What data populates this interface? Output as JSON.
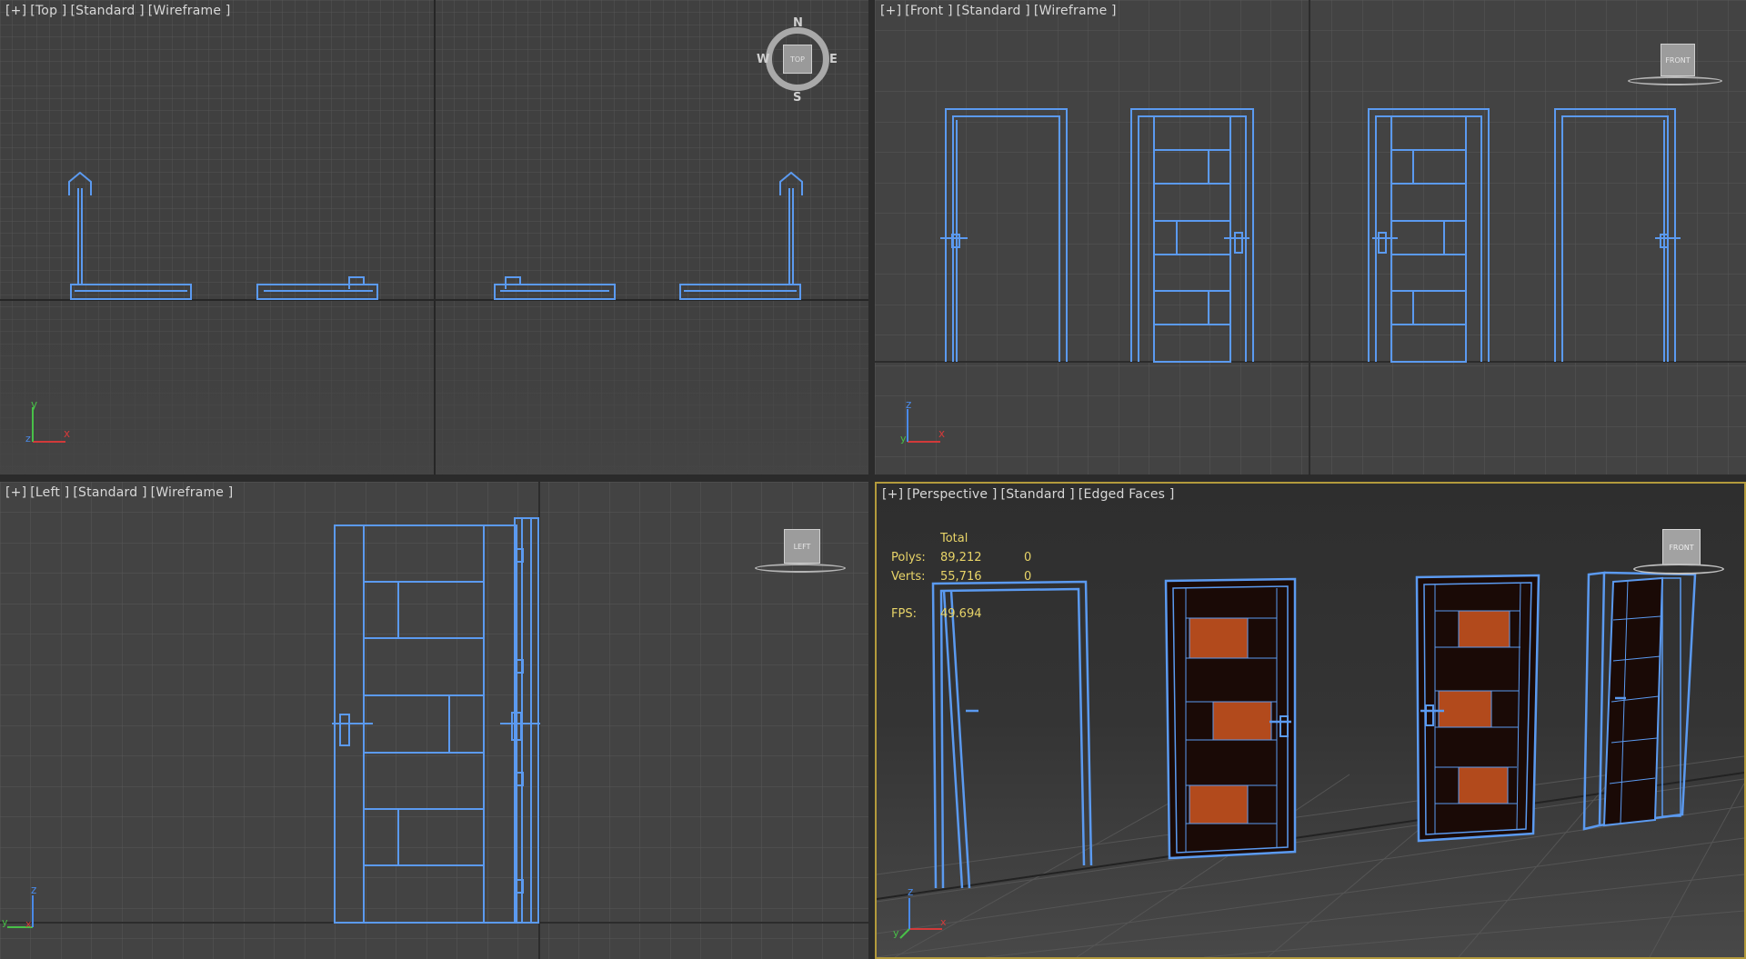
{
  "viewports": {
    "top": {
      "label": {
        "plus": "[+]",
        "view": "[Top ]",
        "shading": "[Standard ]",
        "mode": "[Wireframe ]"
      },
      "compass": {
        "n": "N",
        "s": "S",
        "e": "E",
        "w": "W",
        "cube": "TOP"
      }
    },
    "front": {
      "label": {
        "plus": "[+]",
        "view": "[Front ]",
        "shading": "[Standard ]",
        "mode": "[Wireframe ]"
      },
      "cube": "FRONT"
    },
    "left": {
      "label": {
        "plus": "[+]",
        "view": "[Left ]",
        "shading": "[Standard ]",
        "mode": "[Wireframe ]"
      },
      "cube": "LEFT"
    },
    "perspective": {
      "label": {
        "plus": "[+]",
        "view": "[Perspective ]",
        "shading": "[Standard ]",
        "mode": "[Edged Faces ]"
      },
      "cube": "FRONT",
      "stats": {
        "header": "Total",
        "polys_label": "Polys:",
        "polys_total": "89,212",
        "polys_sel": "0",
        "verts_label": "Verts:",
        "verts_total": "55,716",
        "verts_sel": "0",
        "fps_label": "FPS:",
        "fps_value": "49.694"
      }
    }
  },
  "axis_labels": {
    "x": "x",
    "y": "y",
    "z": "z"
  },
  "colors": {
    "wire": "#5b9af0",
    "grid_line": "#555555",
    "grid_major": "#2c2c2c",
    "axis_x": "#d23a3a",
    "axis_y": "#48c048",
    "axis_z": "#4a8ae8",
    "door_panel": "#1a0a06",
    "door_wood": "#b24a1c",
    "active_border": "#b39a3c",
    "stats_text": "#e8d468"
  }
}
